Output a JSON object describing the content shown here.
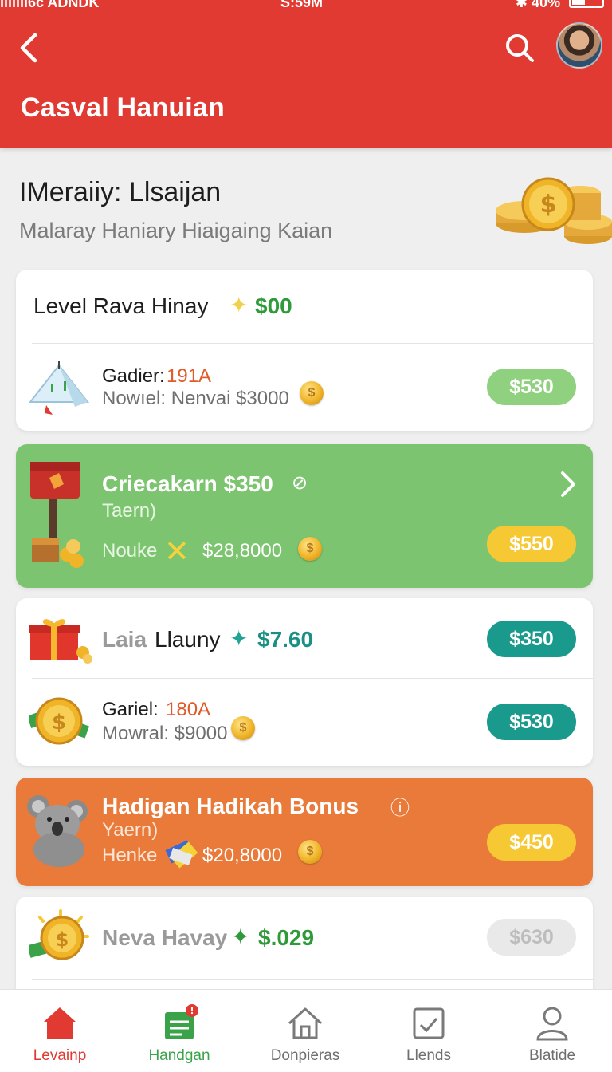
{
  "status_bar": {
    "carrier": "ıılllıı6c ADNDK",
    "time": "S:59M",
    "battery": "40%"
  },
  "app_bar": {
    "title": "Casval Hanuian"
  },
  "hero": {
    "title": "IMeraiiy: Llsaijan",
    "subtitle": "Malaray Haniary Hiaigaing Kaian"
  },
  "cards": {
    "level": {
      "title": "Level Rava Hinay",
      "amount": "$00",
      "row_label_a": "Gadier:",
      "row_value_a": "191A",
      "row_line_b": "Nowıel: Nenvai $3000",
      "pill": "$530"
    },
    "criecakarn": {
      "title": "Criecakarn $350",
      "subtitle": "Taern)",
      "line_label": "Nouke",
      "line_amount": "$28,8000",
      "pill": "$550"
    },
    "laia": {
      "title_gray": "Laia",
      "title_dark": "Llauny",
      "amount": "$7.60",
      "pill_top": "$350",
      "row_label_a": "Gariel:",
      "row_value_a": "180A",
      "row_line_b": "Mowral: $9000",
      "pill_bottom": "$530"
    },
    "hadigan": {
      "title": "Hadigan Hadikah Bonus",
      "subtitle": "Yaern)",
      "line_label": "Henke",
      "line_amount": "$20,8000",
      "pill": "$450"
    },
    "neva": {
      "title": "Neva Havay",
      "amount": "$.029",
      "pill": "$630"
    }
  },
  "bottom_nav": [
    {
      "label": "Levainp"
    },
    {
      "label": "Handgan"
    },
    {
      "label": "Donpieras"
    },
    {
      "label": "Llends"
    },
    {
      "label": "Blatide"
    }
  ],
  "colors": {
    "primary_red": "#e03a32",
    "green": "#7cc46f",
    "orange": "#e97a3a",
    "teal": "#1a9a8c",
    "yellow": "#f6c934"
  }
}
